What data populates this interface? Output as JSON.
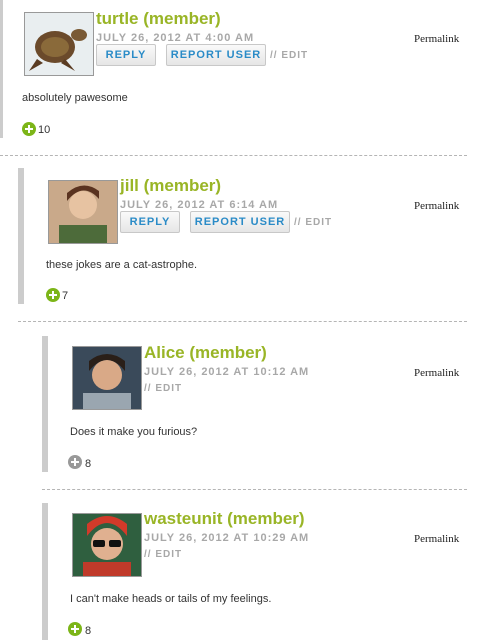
{
  "comments": [
    {
      "author": "turtle (member)",
      "date": "JULY 26, 2012 AT 4:00 AM",
      "reply": "REPLY",
      "report": "REPORT USER",
      "edit": "// EDIT",
      "permalink": "Permalink",
      "body": "absolutely pawesome",
      "votes": "10",
      "vote_color": "#7cb518",
      "avatar_icon": "turtle-avatar"
    },
    {
      "author": "jill (member)",
      "date": "JULY 26, 2012 AT 6:14 AM",
      "reply": "REPLY",
      "report": "REPORT USER",
      "edit": "// EDIT",
      "permalink": "Permalink",
      "body": "these jokes are a cat-astrophe.",
      "votes": "7",
      "vote_color": "#7cb518",
      "avatar_icon": "person-avatar"
    },
    {
      "author": "Alice (member)",
      "date": "JULY 26, 2012 AT 10:12 AM",
      "edit": "// EDIT",
      "permalink": "Permalink",
      "body": "Does it make you furious?",
      "votes": "8",
      "vote_color": "#999999",
      "avatar_icon": "person-avatar"
    },
    {
      "author": "wasteunit (member)",
      "date": "JULY 26, 2012 AT 10:29 AM",
      "edit": "// EDIT",
      "permalink": "Permalink",
      "body": "I can't make heads or tails of my feelings.",
      "votes": "8",
      "vote_color": "#7cb518",
      "avatar_icon": "person-avatar"
    }
  ],
  "colors": {
    "author": "#99b526",
    "link": "#2a8bc7",
    "meta": "#a8a8a8",
    "bar": "#cccccc"
  }
}
